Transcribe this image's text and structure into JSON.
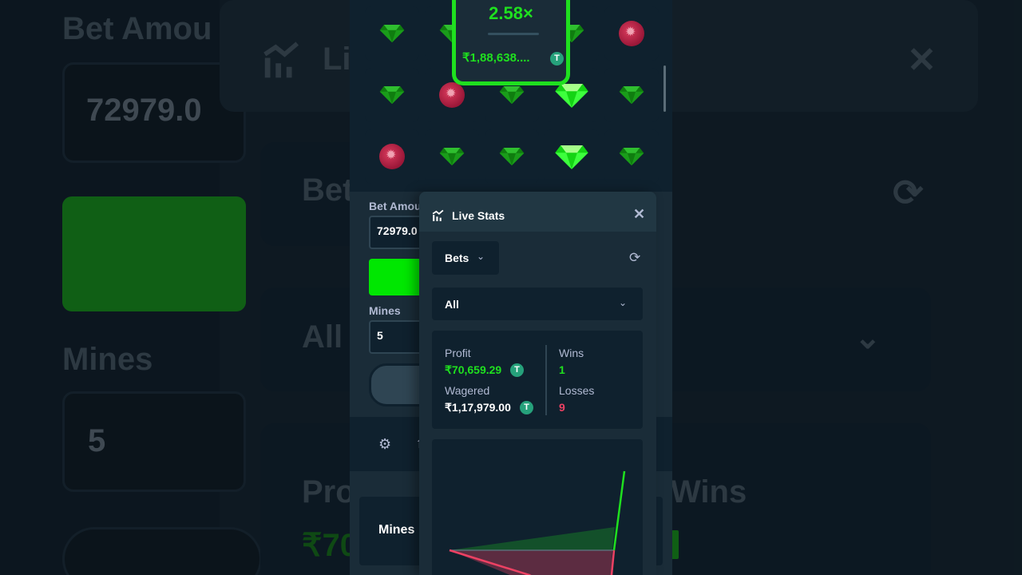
{
  "background": {
    "bet_amount_label": "Bet Amou",
    "bet_amount_value": "72979.0",
    "stats_title": "Li",
    "bets_short": "Bet",
    "filter": "All",
    "mines_label": "Mines",
    "mines_value": "5",
    "profit_short": "Pro",
    "profit_value_short": "₹70",
    "wins_label": "Wins"
  },
  "game": {
    "multiplier": "2.58×",
    "payout": "₹1,88,638....",
    "currency_icon": "tether-icon",
    "grid_rows": [
      [
        "gem",
        "gem",
        "hidden",
        "gem",
        "mine"
      ],
      [
        "gem",
        "mine",
        "gem",
        "gem-selected",
        "gem"
      ],
      [
        "mine",
        "gem",
        "gem",
        "gem-selected",
        "gem"
      ]
    ]
  },
  "controls": {
    "bet_amount_label": "Bet Amou",
    "bet_amount_value": "72979.0",
    "mines_label": "Mines",
    "mines_value": "5",
    "footer_tab": "Mines"
  },
  "live_stats": {
    "title": "Live Stats",
    "close": "✕",
    "bets_dropdown": "Bets",
    "filter_dropdown": "All",
    "profit_label": "Profit",
    "profit_value": "₹70,659.29",
    "wagered_label": "Wagered",
    "wagered_value": "₹1,17,979.00",
    "wins_label": "Wins",
    "wins_value": "1",
    "losses_label": "Losses",
    "losses_value": "9"
  },
  "colors": {
    "accent_green": "#1fe01f",
    "loss_red": "#ed4163",
    "panel": "#1a2c38",
    "dark": "#0f212e"
  }
}
